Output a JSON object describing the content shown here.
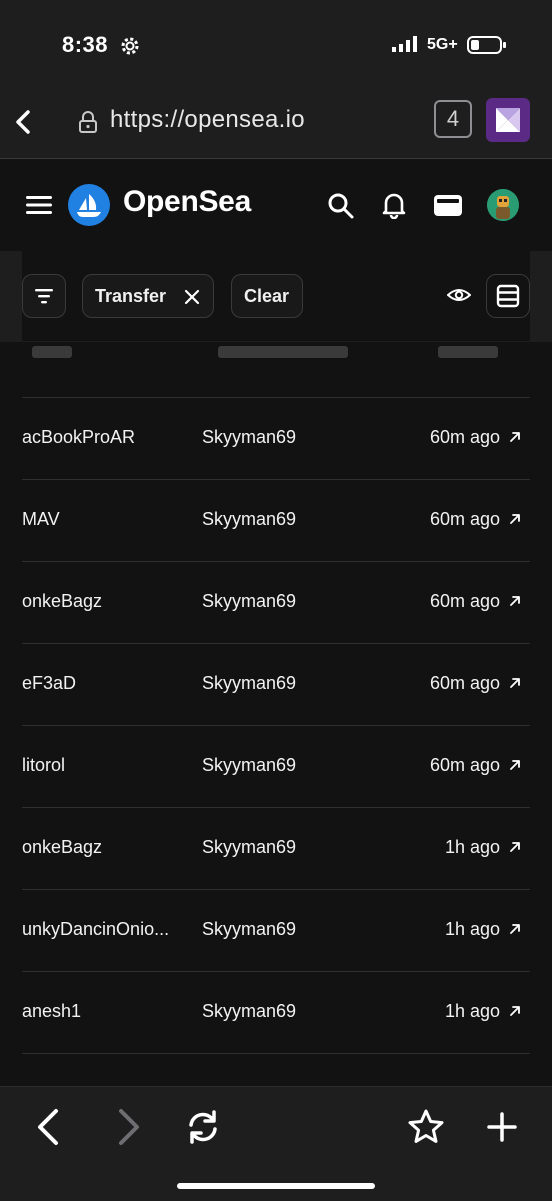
{
  "status_bar": {
    "time": "8:38",
    "network": "5G+"
  },
  "browser": {
    "url": "https://opensea.io",
    "tab_count": "4"
  },
  "header": {
    "brand": "OpenSea"
  },
  "filters": {
    "active_chip": "Transfer",
    "clear_label": "Clear"
  },
  "rows": [
    {
      "name": "acBookProAR",
      "user": "Skyyman69",
      "time": "60m ago"
    },
    {
      "name": "MAV",
      "user": "Skyyman69",
      "time": "60m ago"
    },
    {
      "name": "onkeBagz",
      "user": "Skyyman69",
      "time": "60m ago"
    },
    {
      "name": "eF3aD",
      "user": "Skyyman69",
      "time": "60m ago"
    },
    {
      "name": "litorol",
      "user": "Skyyman69",
      "time": "60m ago"
    },
    {
      "name": "onkeBagz",
      "user": "Skyyman69",
      "time": "1h ago"
    },
    {
      "name": "unkyDancinOnio...",
      "user": "Skyyman69",
      "time": "1h ago"
    },
    {
      "name": "anesh1",
      "user": "Skyyman69",
      "time": "1h ago"
    }
  ],
  "icons": {
    "status": [
      "gear-icon",
      "signal-icon",
      "battery-icon"
    ],
    "url_bar": [
      "back-icon",
      "lock-icon",
      "tabs-icon",
      "extension-icon"
    ],
    "header": [
      "menu-icon",
      "opensea-logo-icon",
      "search-icon",
      "bell-icon",
      "wallet-icon",
      "avatar"
    ],
    "filters": [
      "filter-icon",
      "close-icon",
      "eye-icon",
      "list-view-icon"
    ],
    "toolbar": [
      "back-arrow-icon",
      "forward-arrow-icon",
      "reload-icon",
      "star-icon",
      "plus-icon"
    ]
  },
  "colors": {
    "brand_blue": "#2081e2",
    "background": "#121212",
    "browser_chrome": "#1e1e1f",
    "extension_purple": "#5a2a84"
  }
}
